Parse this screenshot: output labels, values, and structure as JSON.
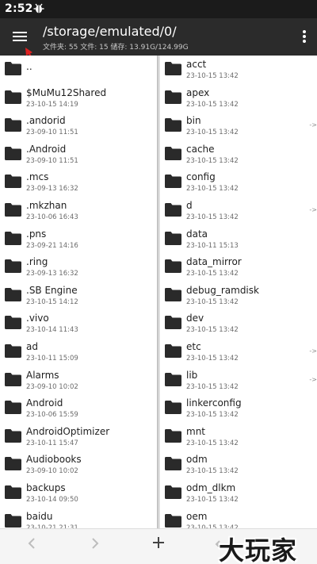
{
  "status_bar": {
    "time": "2:52",
    "notification_icon": "bug-icon"
  },
  "toolbar": {
    "menu_icon": "hamburger-menu-icon",
    "path": "/storage/emulated/0/",
    "summary": "文件夹: 55  文件: 15  储存: 13.91G/124.99G",
    "overflow_icon": "more-vert-icon"
  },
  "left_pane": {
    "items": [
      {
        "name": "..",
        "date": ""
      },
      {
        "name": "$MuMu12Shared",
        "date": "23-10-15 14:19"
      },
      {
        "name": ".andorid",
        "date": "23-09-10 11:51"
      },
      {
        "name": ".Android",
        "date": "23-09-10 11:51"
      },
      {
        "name": ".mcs",
        "date": "23-09-13 16:32"
      },
      {
        "name": ".mkzhan",
        "date": "23-10-06 16:43"
      },
      {
        "name": ".pns",
        "date": "23-09-21 14:16"
      },
      {
        "name": ".ring",
        "date": "23-09-13 16:32"
      },
      {
        "name": ".SB Engine",
        "date": "23-10-15 14:12"
      },
      {
        "name": ".vivo",
        "date": "23-10-14 11:43"
      },
      {
        "name": "ad",
        "date": "23-10-11 15:09"
      },
      {
        "name": "Alarms",
        "date": "23-09-10 10:02"
      },
      {
        "name": "Android",
        "date": "23-10-06 15:59"
      },
      {
        "name": "AndroidOptimizer",
        "date": "23-10-11 15:47"
      },
      {
        "name": "Audiobooks",
        "date": "23-09-10 10:02"
      },
      {
        "name": "backups",
        "date": "23-10-14 09:50"
      },
      {
        "name": "baidu",
        "date": "23-10-21 21:31"
      }
    ]
  },
  "right_pane": {
    "items": [
      {
        "name": "acct",
        "date": "23-10-15 13:42",
        "link": false
      },
      {
        "name": "apex",
        "date": "23-10-15 13:42",
        "link": false
      },
      {
        "name": "bin",
        "date": "23-10-15 13:42",
        "link": true
      },
      {
        "name": "cache",
        "date": "23-10-15 13:42",
        "link": false
      },
      {
        "name": "config",
        "date": "23-10-15 13:42",
        "link": false
      },
      {
        "name": "d",
        "date": "23-10-15 13:42",
        "link": true
      },
      {
        "name": "data",
        "date": "23-10-11 15:13",
        "link": false
      },
      {
        "name": "data_mirror",
        "date": "23-10-15 13:42",
        "link": false
      },
      {
        "name": "debug_ramdisk",
        "date": "23-10-15 13:42",
        "link": false
      },
      {
        "name": "dev",
        "date": "23-10-15 13:42",
        "link": false
      },
      {
        "name": "etc",
        "date": "23-10-15 13:42",
        "link": true
      },
      {
        "name": "lib",
        "date": "23-10-15 13:42",
        "link": true
      },
      {
        "name": "linkerconfig",
        "date": "23-10-15 13:42",
        "link": false
      },
      {
        "name": "mnt",
        "date": "23-10-15 13:42",
        "link": false
      },
      {
        "name": "odm",
        "date": "23-10-15 13:42",
        "link": false
      },
      {
        "name": "odm_dlkm",
        "date": "23-10-15 13:42",
        "link": false
      },
      {
        "name": "oem",
        "date": "23-10-15 13:42",
        "link": false
      }
    ],
    "link_arrow": "->"
  },
  "bottom_bar": {
    "back_icon": "chevron-left-icon",
    "forward_icon": "chevron-right-icon",
    "add_icon": "plus-icon",
    "swap_icon": "swap-icon"
  },
  "watermark": {
    "text": "大玩家"
  },
  "colors": {
    "toolbar": "#2b2b2b",
    "status_bar": "#1b1b1b",
    "folder": "#2a2a2a",
    "annotation": "#e02020"
  }
}
